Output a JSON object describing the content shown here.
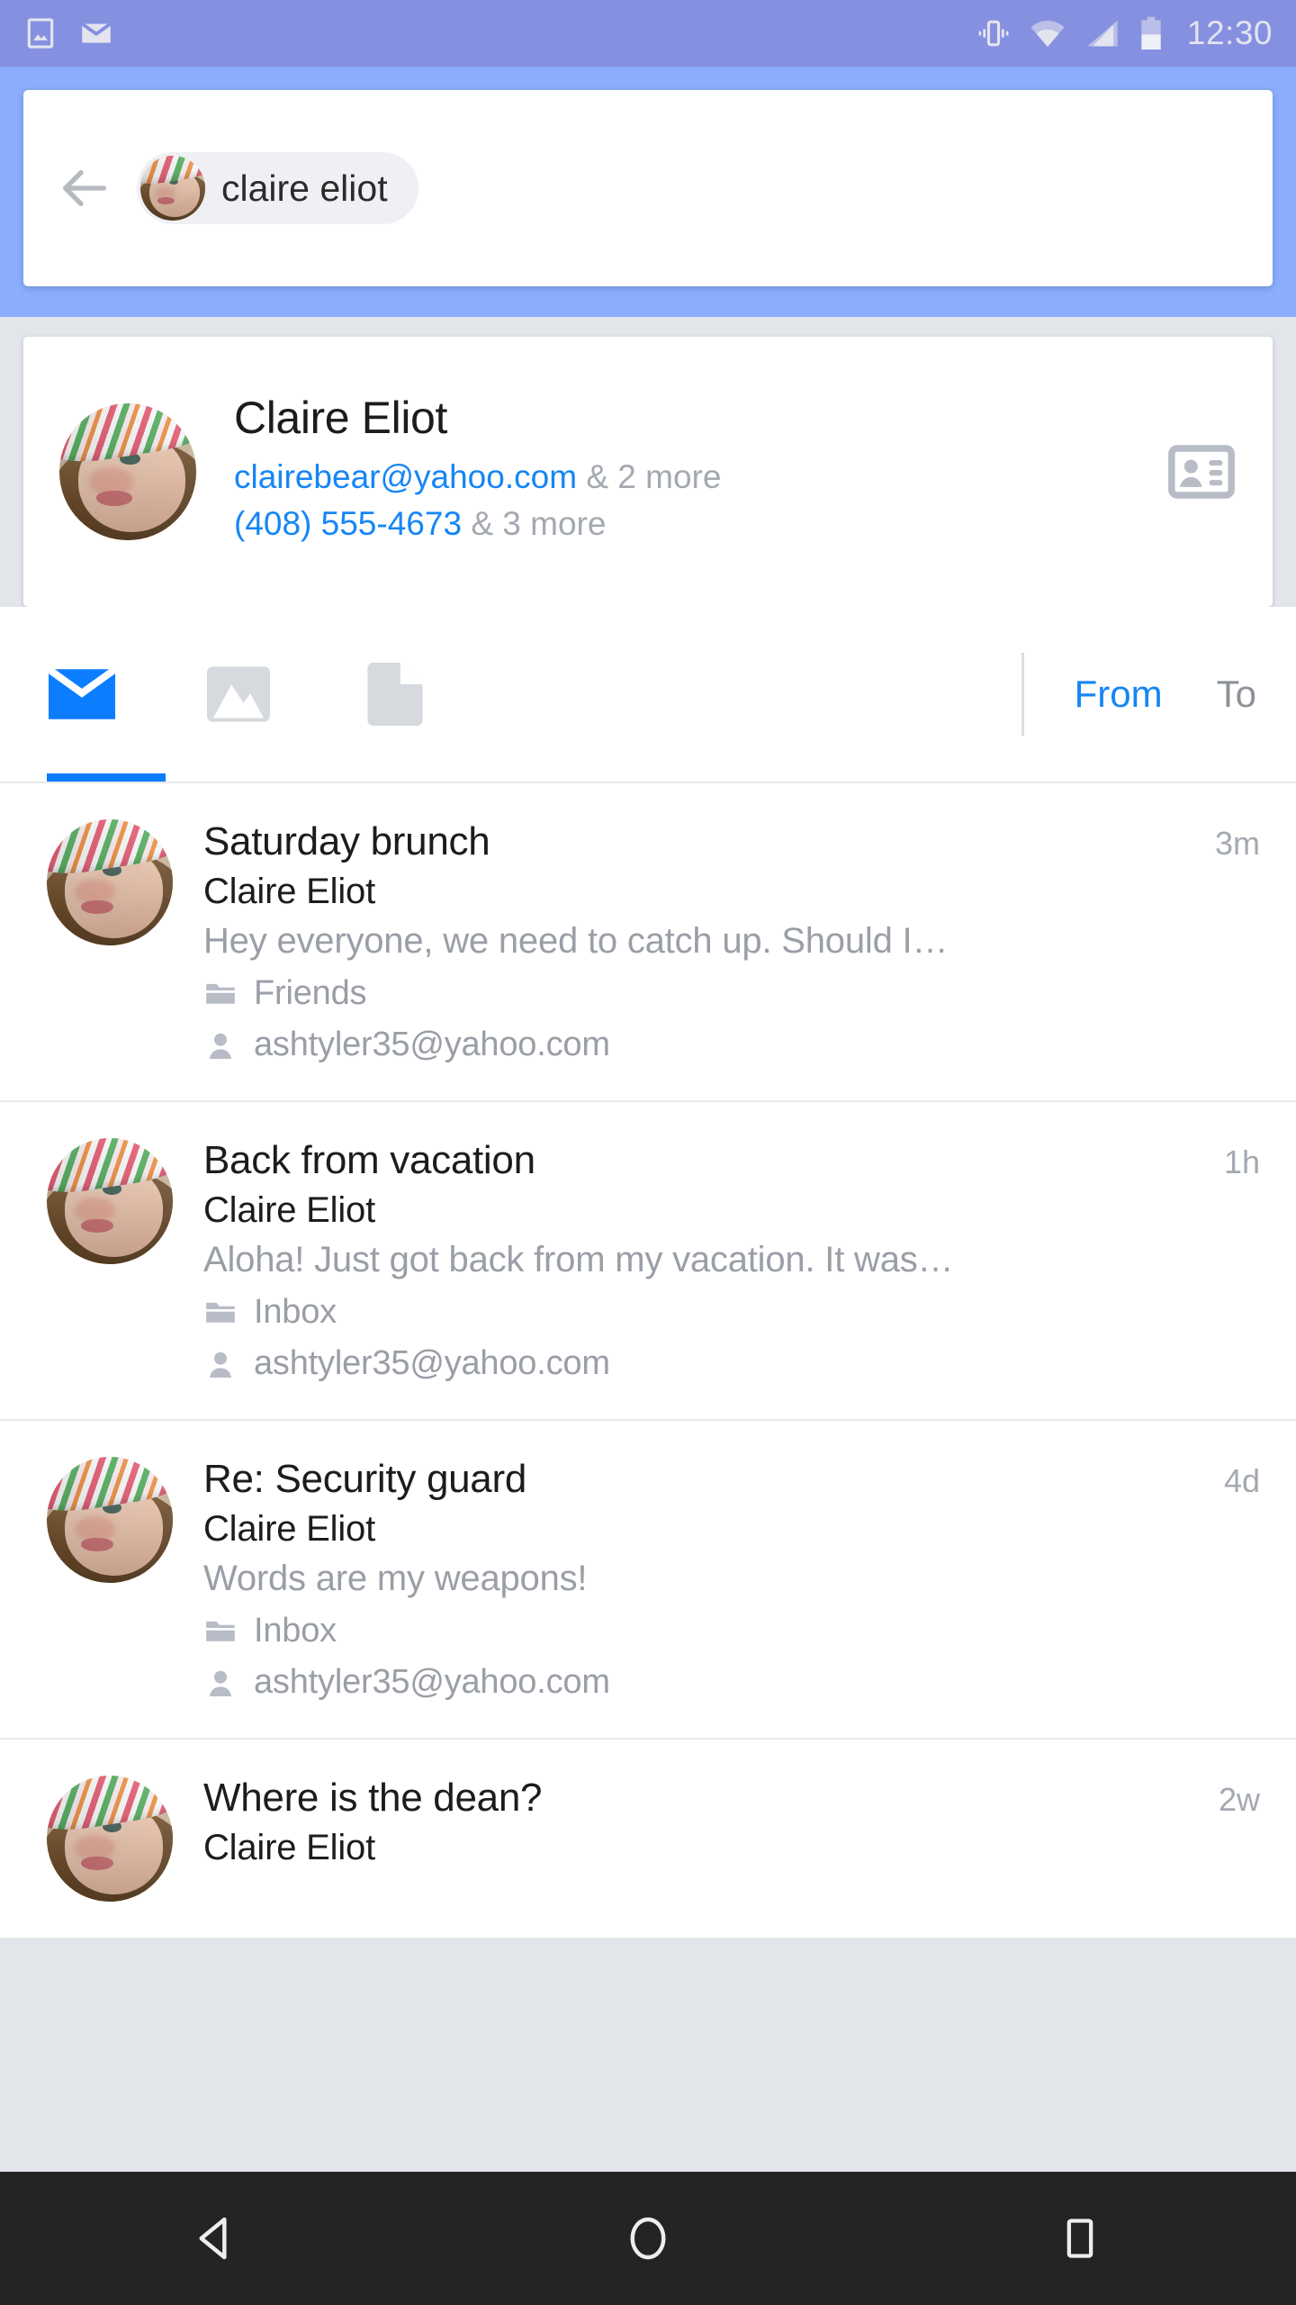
{
  "statusbar": {
    "time": "12:30",
    "left_icons": [
      "photo-notification-icon",
      "mail-notification-icon"
    ],
    "right_icons": [
      "vibrate-icon",
      "wifi-icon",
      "cellular-signal-icon",
      "battery-icon"
    ],
    "bg_color": "#8690e0"
  },
  "header": {
    "bg_color": "#8aaefb",
    "back_label": "back-arrow",
    "search_chip": {
      "text": "claire eliot",
      "avatar": "claire-eliot-avatar"
    }
  },
  "contact": {
    "name": "Claire Eliot",
    "email": "clairebear@yahoo.com",
    "email_more": "& 2 more",
    "phone": "(408) 555-4673",
    "phone_more": "& 3 more",
    "link_color": "#1686f4",
    "card_icon": "contact-card-icon"
  },
  "tabs": {
    "icons": [
      {
        "name": "mail-icon",
        "active": true
      },
      {
        "name": "image-icon",
        "active": false
      },
      {
        "name": "document-icon",
        "active": false
      }
    ],
    "from_label": "From",
    "to_label": "To",
    "active_word": "From",
    "accent_color": "#0d7dff"
  },
  "emails": [
    {
      "subject": "Saturday brunch",
      "sender": "Claire Eliot",
      "preview": "Hey everyone, we need to catch up. Should I…",
      "folder": "Friends",
      "recipient": "ashtyler35@yahoo.com",
      "time": "3m"
    },
    {
      "subject": "Back from vacation",
      "sender": "Claire Eliot",
      "preview": "Aloha! Just got back from my vacation. It was…",
      "folder": "Inbox",
      "recipient": "ashtyler35@yahoo.com",
      "time": "1h"
    },
    {
      "subject": "Re: Security guard",
      "sender": "Claire Eliot",
      "preview": "Words are my weapons!",
      "folder": "Inbox",
      "recipient": "ashtyler35@yahoo.com",
      "time": "4d"
    },
    {
      "subject": "Where is the dean?",
      "sender": "Claire Eliot",
      "preview": "",
      "folder": "",
      "recipient": "",
      "time": "2w"
    }
  ],
  "navbar": {
    "back": "nav-back-icon",
    "home": "nav-home-icon",
    "recents": "nav-recents-icon",
    "bg_color": "#242424"
  }
}
